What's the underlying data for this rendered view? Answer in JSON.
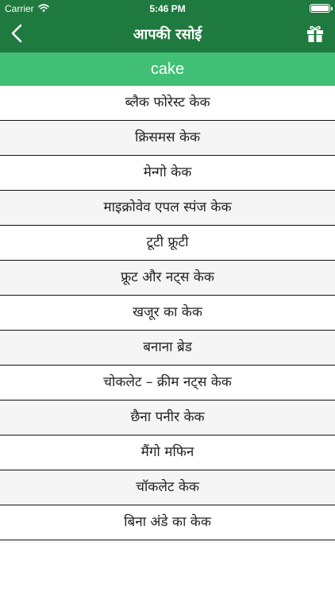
{
  "status_bar": {
    "carrier": "Carrier",
    "time": "5:46 PM",
    "battery_level": 1.0
  },
  "nav": {
    "title": "आपकी रसोई",
    "back_icon": "chevron-left-icon",
    "gift_icon": "gift-icon"
  },
  "section": {
    "title": "cake"
  },
  "recipes": [
    {
      "label": "ब्लैक फोरेस्ट केक"
    },
    {
      "label": "क्रिसमस केक"
    },
    {
      "label": "मेन्गो केक"
    },
    {
      "label": "माइक्रोवेव एपल स्पंज केक"
    },
    {
      "label": "टूटी फ्रूटी"
    },
    {
      "label": "फ्रूट और नट्स केक"
    },
    {
      "label": "खजूर का केक"
    },
    {
      "label": "बनाना ब्रेड"
    },
    {
      "label": "चोकलेट – क्रीम नट्स केक"
    },
    {
      "label": "छैना पनीर केक"
    },
    {
      "label": "मैंगो मफिन"
    },
    {
      "label": "चॉकलेट केक"
    },
    {
      "label": "बिना अंडे का केक"
    }
  ],
  "colors": {
    "nav_bar": "#1f7a3f",
    "section_header": "#40bf75",
    "divider": "#111111"
  }
}
